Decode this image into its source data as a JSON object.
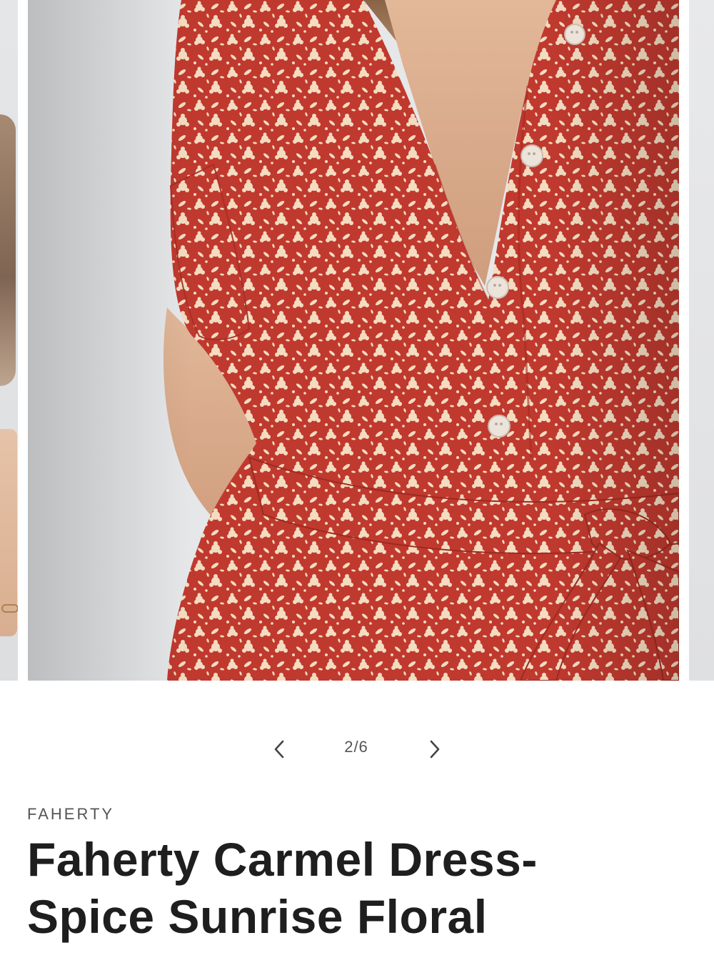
{
  "carousel": {
    "pager": {
      "current": "2/6",
      "prev_icon": "chevron-left-icon",
      "next_icon": "chevron-right-icon"
    },
    "colors": {
      "dress_red": "#c0392f",
      "floral_cream": "#f3dcc0",
      "backdrop": "#e6e7e9"
    }
  },
  "product": {
    "brand": "FAHERTY",
    "title_line1": "Faherty Carmel Dress-",
    "title_line2": "Spice Sunrise Floral"
  }
}
